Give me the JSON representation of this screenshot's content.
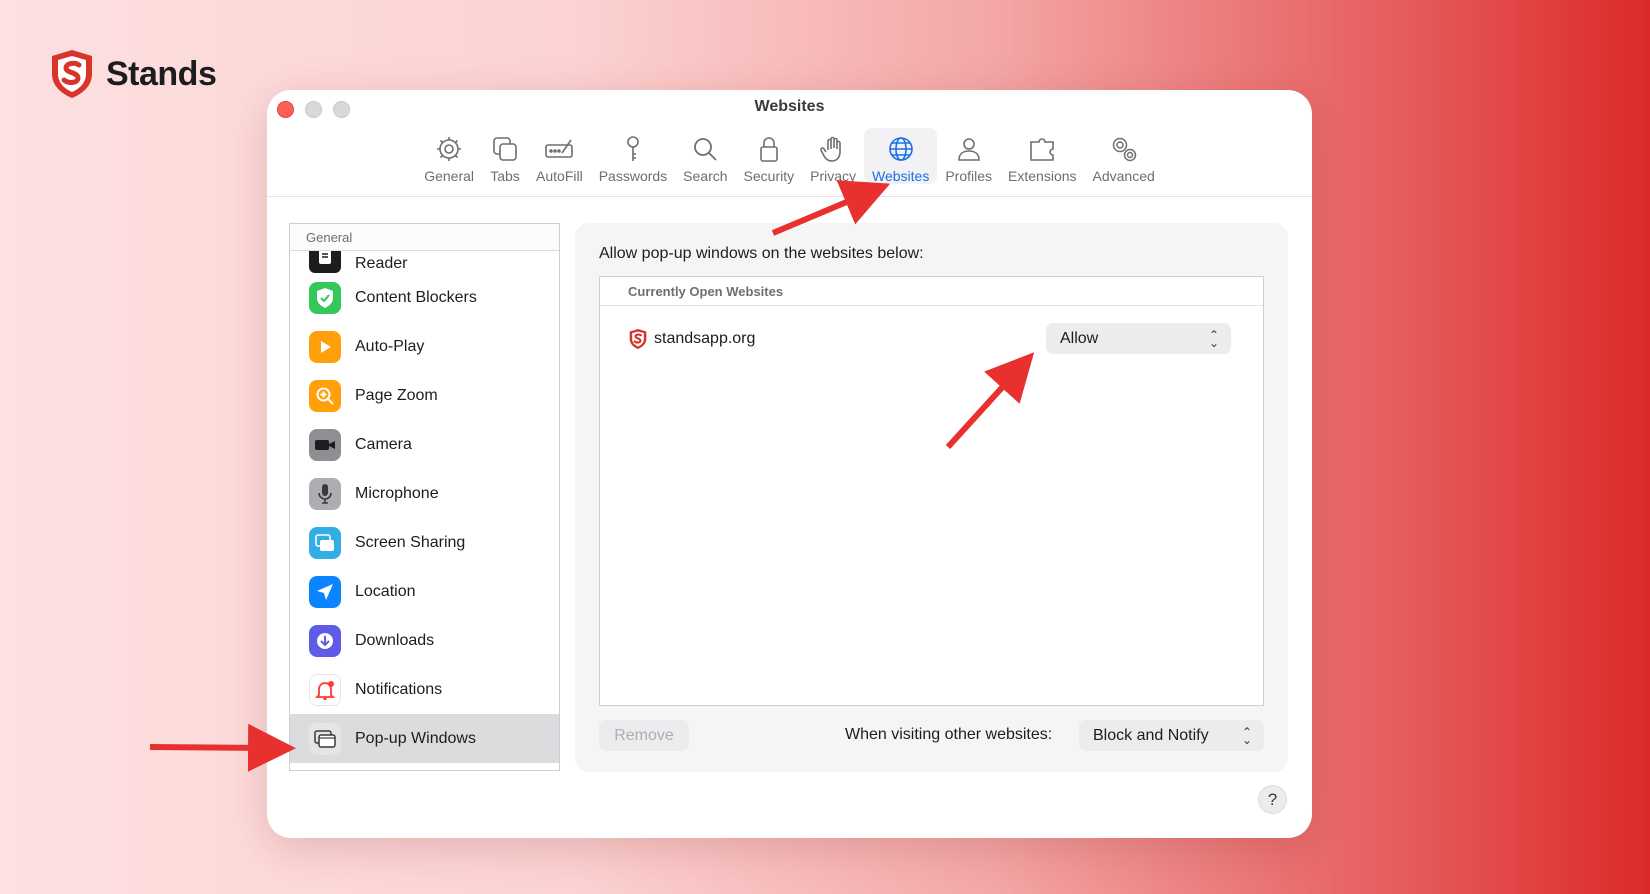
{
  "brand": {
    "name": "Stands"
  },
  "window": {
    "title": "Websites"
  },
  "toolbar": {
    "tabs": [
      {
        "label": "General",
        "icon": "gear-icon"
      },
      {
        "label": "Tabs",
        "icon": "tabs-icon"
      },
      {
        "label": "AutoFill",
        "icon": "autofill-icon"
      },
      {
        "label": "Passwords",
        "icon": "key-icon"
      },
      {
        "label": "Search",
        "icon": "magnifier-icon"
      },
      {
        "label": "Security",
        "icon": "lock-icon"
      },
      {
        "label": "Privacy",
        "icon": "hand-icon"
      },
      {
        "label": "Websites",
        "icon": "globe-icon",
        "active": true
      },
      {
        "label": "Profiles",
        "icon": "person-icon"
      },
      {
        "label": "Extensions",
        "icon": "puzzle-icon"
      },
      {
        "label": "Advanced",
        "icon": "gears-icon"
      }
    ]
  },
  "sidebar": {
    "header": "General",
    "items": [
      {
        "label": "Reader",
        "icon": "reader-icon",
        "color": "#1d1d1f"
      },
      {
        "label": "Content Blockers",
        "icon": "shield-check-icon",
        "color": "#34c759"
      },
      {
        "label": "Auto-Play",
        "icon": "play-icon",
        "color": "#ff9f0a"
      },
      {
        "label": "Page Zoom",
        "icon": "zoom-icon",
        "color": "#ff9f0a"
      },
      {
        "label": "Camera",
        "icon": "camera-icon",
        "color": "#636366"
      },
      {
        "label": "Microphone",
        "icon": "microphone-icon",
        "color": "#8e8e93"
      },
      {
        "label": "Screen Sharing",
        "icon": "screen-sharing-icon",
        "color": "#32ade6"
      },
      {
        "label": "Location",
        "icon": "location-icon",
        "color": "#0a84ff"
      },
      {
        "label": "Downloads",
        "icon": "download-icon",
        "color": "#5e5ce6"
      },
      {
        "label": "Notifications",
        "icon": "bell-icon",
        "color": "#ff3b30"
      },
      {
        "label": "Pop-up Windows",
        "icon": "popup-windows-icon",
        "color": "#8e8e93",
        "selected": true
      }
    ]
  },
  "main": {
    "description": "Allow pop-up windows on the websites below:",
    "list_header": "Currently Open Websites",
    "sites": [
      {
        "name": "standsapp.org",
        "setting": "Allow"
      }
    ],
    "remove_label": "Remove",
    "other_label": "When visiting other websites:",
    "other_value": "Block and Notify",
    "help_label": "?"
  },
  "colors": {
    "accent": "#1a6fe6",
    "arrow": "#e8312f",
    "brand": "#d9342b"
  }
}
